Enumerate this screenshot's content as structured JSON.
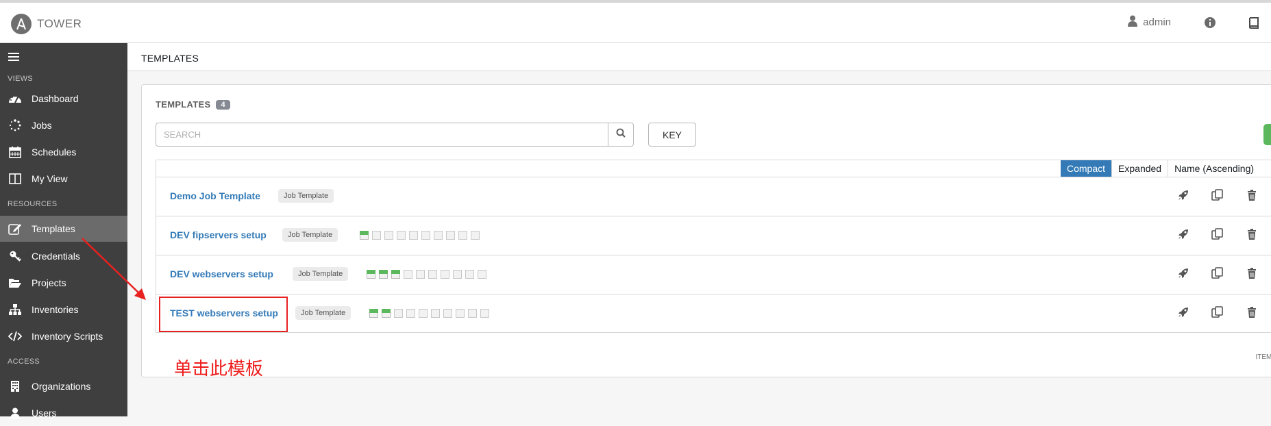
{
  "header": {
    "app_name": "TOWER",
    "username": "admin",
    "icons": [
      "logo-icon",
      "user-icon",
      "info-icon",
      "book-icon"
    ]
  },
  "sidebar": {
    "sections": [
      {
        "label": "VIEWS"
      },
      {
        "label": "RESOURCES"
      },
      {
        "label": "ACCESS"
      }
    ],
    "items": [
      {
        "label": "Dashboard",
        "icon": "dashboard-icon"
      },
      {
        "label": "Jobs",
        "icon": "spinner-icon"
      },
      {
        "label": "Schedules",
        "icon": "calendar-icon"
      },
      {
        "label": "My View",
        "icon": "columns-icon"
      },
      {
        "label": "Templates",
        "icon": "edit-icon",
        "active": true
      },
      {
        "label": "Credentials",
        "icon": "key-icon"
      },
      {
        "label": "Projects",
        "icon": "folder-open-icon"
      },
      {
        "label": "Inventories",
        "icon": "sitemap-icon"
      },
      {
        "label": "Inventory Scripts",
        "icon": "code-icon"
      },
      {
        "label": "Organizations",
        "icon": "building-icon"
      },
      {
        "label": "Users",
        "icon": "user-icon"
      }
    ]
  },
  "breadcrumb": "TEMPLATES",
  "panel": {
    "title": "TEMPLATES",
    "count": "4",
    "search_placeholder": "SEARCH",
    "key_label": "KEY"
  },
  "list": {
    "view_modes": [
      "Compact",
      "Expanded",
      "Name (Ascending)"
    ],
    "active_view": "Compact",
    "rows": [
      {
        "name": "Demo Job Template",
        "type": "Job Template",
        "recent_jobs": []
      },
      {
        "name": "DEV fipservers setup",
        "type": "Job Template",
        "recent_jobs": [
          "successful",
          "none",
          "none",
          "none",
          "none",
          "none",
          "none",
          "none",
          "none",
          "none"
        ]
      },
      {
        "name": "DEV webservers setup",
        "type": "Job Template",
        "recent_jobs": [
          "successful",
          "successful",
          "successful",
          "none",
          "none",
          "none",
          "none",
          "none",
          "none",
          "none"
        ]
      },
      {
        "name": "TEST webservers setup",
        "type": "Job Template",
        "recent_jobs": [
          "successful",
          "successful",
          "none",
          "none",
          "none",
          "none",
          "none",
          "none",
          "none",
          "none"
        ]
      }
    ],
    "row_action_icons": [
      "rocket-icon",
      "copy-icon",
      "trash-icon"
    ],
    "items_label": "ITEMS"
  },
  "annotation": {
    "text": "单击此模板",
    "color": "#ee1c1c"
  },
  "colors": {
    "sidebar_bg": "#3f3f3f",
    "sidebar_active": "#6b6b6b",
    "link": "#337ab7",
    "success": "#5cb85c",
    "annotation": "#ee1c1c"
  }
}
